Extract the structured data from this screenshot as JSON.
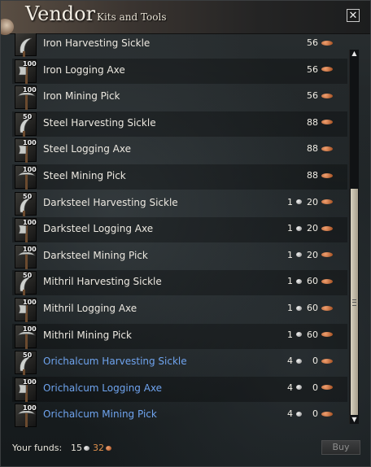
{
  "window": {
    "title": "Vendor",
    "subtitle": "Kits and Tools",
    "close_glyph": "✕"
  },
  "items": [
    {
      "tier": "",
      "name": "Iron Harvesting Sickle",
      "tool": "sickle-icon",
      "gold": "",
      "silver": "",
      "copper": "56",
      "blue": false
    },
    {
      "tier": "100",
      "name": "Iron Logging Axe",
      "tool": "axe-icon",
      "gold": "",
      "silver": "",
      "copper": "56",
      "blue": false
    },
    {
      "tier": "100",
      "name": "Iron Mining Pick",
      "tool": "pick-icon",
      "gold": "",
      "silver": "",
      "copper": "56",
      "blue": false
    },
    {
      "tier": "50",
      "name": "Steel Harvesting Sickle",
      "tool": "sickle-icon",
      "gold": "",
      "silver": "",
      "copper": "88",
      "blue": false
    },
    {
      "tier": "100",
      "name": "Steel Logging Axe",
      "tool": "axe-icon",
      "gold": "",
      "silver": "",
      "copper": "88",
      "blue": false
    },
    {
      "tier": "100",
      "name": "Steel Mining Pick",
      "tool": "pick-icon",
      "gold": "",
      "silver": "",
      "copper": "88",
      "blue": false
    },
    {
      "tier": "50",
      "name": "Darksteel Harvesting Sickle",
      "tool": "sickle-icon",
      "gold": "",
      "silver": "1",
      "copper": "20",
      "blue": false
    },
    {
      "tier": "100",
      "name": "Darksteel Logging Axe",
      "tool": "axe-icon",
      "gold": "",
      "silver": "1",
      "copper": "20",
      "blue": false
    },
    {
      "tier": "100",
      "name": "Darksteel Mining Pick",
      "tool": "pick-icon",
      "gold": "",
      "silver": "1",
      "copper": "20",
      "blue": false
    },
    {
      "tier": "50",
      "name": "Mithril Harvesting Sickle",
      "tool": "sickle-icon",
      "gold": "",
      "silver": "1",
      "copper": "60",
      "blue": false
    },
    {
      "tier": "100",
      "name": "Mithril Logging Axe",
      "tool": "axe-icon",
      "gold": "",
      "silver": "1",
      "copper": "60",
      "blue": false
    },
    {
      "tier": "100",
      "name": "Mithril Mining Pick",
      "tool": "pick-icon",
      "gold": "",
      "silver": "1",
      "copper": "60",
      "blue": false
    },
    {
      "tier": "50",
      "name": "Orichalcum Harvesting Sickle",
      "tool": "sickle-icon",
      "gold": "",
      "silver": "4",
      "copper": "0",
      "blue": true
    },
    {
      "tier": "100",
      "name": "Orichalcum Logging Axe",
      "tool": "axe-icon",
      "gold": "",
      "silver": "4",
      "copper": "0",
      "blue": true
    },
    {
      "tier": "100",
      "name": "Orichalcum Mining Pick",
      "tool": "pick-icon",
      "gold": "",
      "silver": "4",
      "copper": "0",
      "blue": true
    }
  ],
  "footer": {
    "funds_label": "Your funds:",
    "silver": "15",
    "copper": "32",
    "buy_label": "Buy"
  },
  "colors": {
    "normal_item": "#ece8e0",
    "blue_item": "#6fa4ef",
    "copper_coin": "#c46a33",
    "silver_coin": "#c8c8c8"
  }
}
